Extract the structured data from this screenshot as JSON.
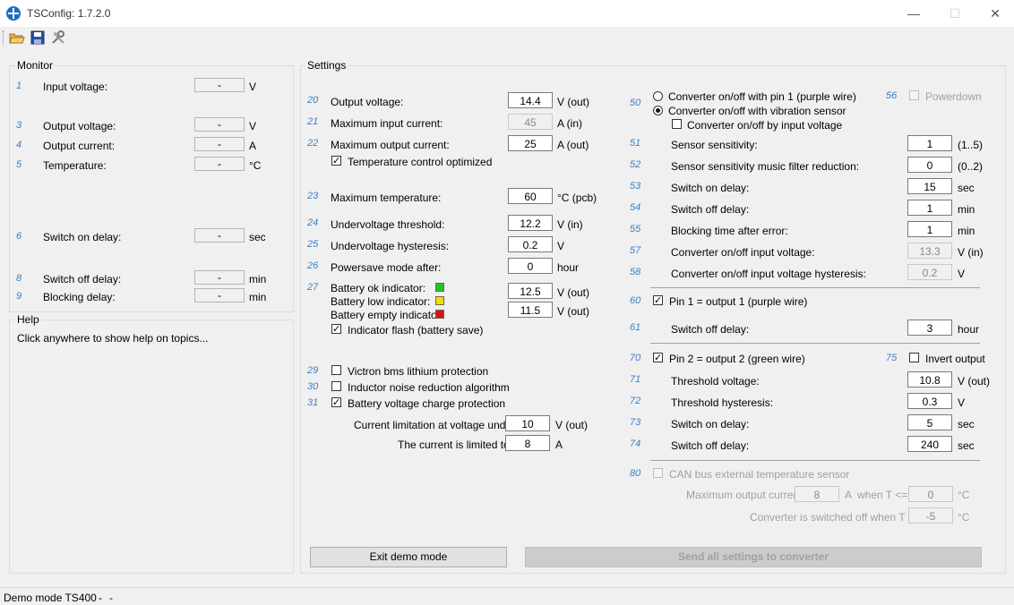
{
  "window": {
    "title": "TSConfig: 1.7.2.0"
  },
  "monitor": {
    "title": "Monitor",
    "rows": [
      {
        "num": "1",
        "label": "Input voltage:",
        "value": "-",
        "unit": "V"
      },
      {
        "num": "3",
        "label": "Output voltage:",
        "value": "-",
        "unit": "V"
      },
      {
        "num": "4",
        "label": "Output current:",
        "value": "-",
        "unit": "A"
      },
      {
        "num": "5",
        "label": "Temperature:",
        "value": "-",
        "unit": "°C"
      },
      {
        "num": "6",
        "label": "Switch on delay:",
        "value": "-",
        "unit": "sec"
      },
      {
        "num": "8",
        "label": "Switch off delay:",
        "value": "-",
        "unit": "min"
      },
      {
        "num": "9",
        "label": "Blocking delay:",
        "value": "-",
        "unit": "min"
      }
    ]
  },
  "help": {
    "title": "Help",
    "text": "Click anywhere to show help on topics..."
  },
  "settings": {
    "title": "Settings",
    "left": {
      "r20": {
        "num": "20",
        "label": "Output voltage:",
        "value": "14.4",
        "unit": "V (out)"
      },
      "r21": {
        "num": "21",
        "label": "Maximum input current:",
        "value": "45",
        "unit": "A (in)"
      },
      "r22": {
        "num": "22",
        "label": "Maximum output current:",
        "value": "25",
        "unit": "A (out)"
      },
      "temp_ctrl": "Temperature control optimized",
      "r23": {
        "num": "23",
        "label": "Maximum temperature:",
        "value": "60",
        "unit": "°C (pcb)"
      },
      "r24": {
        "num": "24",
        "label": "Undervoltage threshold:",
        "value": "12.2",
        "unit": "V (in)"
      },
      "r25": {
        "num": "25",
        "label": "Undervoltage hysteresis:",
        "value": "0.2",
        "unit": "V"
      },
      "r26": {
        "num": "26",
        "label": "Powersave mode after:",
        "value": "0",
        "unit": "hour"
      },
      "r27": {
        "num": "27",
        "ok_label": "Battery ok indicator:",
        "ok_color": "#1ec81e",
        "low_label": "Battery low indicator:",
        "low_color": "#f0e000",
        "empty_label": "Battery empty indicator:",
        "empty_color": "#e01010",
        "ok_value": "12.5",
        "ok_unit": "V (out)",
        "empty_value": "11.5",
        "empty_unit": "V (out)",
        "flash_label": "Indicator flash (battery save)"
      },
      "r29": {
        "num": "29",
        "label": "Victron bms lithium protection"
      },
      "r30": {
        "num": "30",
        "label": "Inductor noise reduction algorithm"
      },
      "r31": {
        "num": "31",
        "label": "Battery voltage charge protection"
      },
      "cur_lim_label": "Current limitation at voltage under:",
      "cur_lim_value": "10",
      "cur_lim_unit": "V (out)",
      "limited_label": "The current is limited to:",
      "limited_value": "8",
      "limited_unit": "A"
    },
    "right": {
      "r50": {
        "num": "50",
        "radio1": "Converter on/off with pin 1 (purple wire)",
        "radio2": "Converter on/off with vibration sensor",
        "by_input": "Converter on/off by input voltage"
      },
      "r56": {
        "num": "56",
        "label": "Powerdown"
      },
      "r51": {
        "num": "51",
        "label": "Sensor sensitivity:",
        "value": "1",
        "unit": "(1..5)"
      },
      "r52": {
        "num": "52",
        "label": "Sensor sensitivity music filter reduction:",
        "value": "0",
        "unit": "(0..2)"
      },
      "r53": {
        "num": "53",
        "label": "Switch on delay:",
        "value": "15",
        "unit": "sec"
      },
      "r54": {
        "num": "54",
        "label": "Switch off delay:",
        "value": "1",
        "unit": "min"
      },
      "r55": {
        "num": "55",
        "label": "Blocking time after error:",
        "value": "1",
        "unit": "min"
      },
      "r57": {
        "num": "57",
        "label": "Converter on/off input voltage:",
        "value": "13.3",
        "unit": "V (in)"
      },
      "r58": {
        "num": "58",
        "label": "Converter on/off input voltage hysteresis:",
        "value": "0.2",
        "unit": "V"
      },
      "r60": {
        "num": "60",
        "label": "Pin 1 = output 1 (purple wire)"
      },
      "r61": {
        "num": "61",
        "label": "Switch off delay:",
        "value": "3",
        "unit": "hour"
      },
      "r70": {
        "num": "70",
        "label": "Pin 2 = output 2 (green wire)"
      },
      "r75": {
        "num": "75",
        "label": "Invert output"
      },
      "r71": {
        "num": "71",
        "label": "Threshold voltage:",
        "value": "10.8",
        "unit": "V (out)"
      },
      "r72": {
        "num": "72",
        "label": "Threshold hysteresis:",
        "value": "0.3",
        "unit": "V"
      },
      "r73": {
        "num": "73",
        "label": "Switch on delay:",
        "value": "5",
        "unit": "sec"
      },
      "r74": {
        "num": "74",
        "label": "Switch off delay:",
        "value": "240",
        "unit": "sec"
      },
      "r80": {
        "num": "80",
        "label": "CAN bus external temperature sensor"
      },
      "can_max_label": "Maximum output current:",
      "can_max_value": "8",
      "can_max_unit": "A",
      "can_when": "when T <=",
      "can_t1": "0",
      "can_t1_unit": "°C",
      "can_off_label": "Converter is switched off when T <=",
      "can_t2": "-5",
      "can_t2_unit": "°C"
    },
    "exit_button": "Exit demo mode",
    "send_button": "Send all settings to converter"
  },
  "status": {
    "text": "Demo mode TS400",
    "sep1": "-",
    "sep2": "-"
  }
}
